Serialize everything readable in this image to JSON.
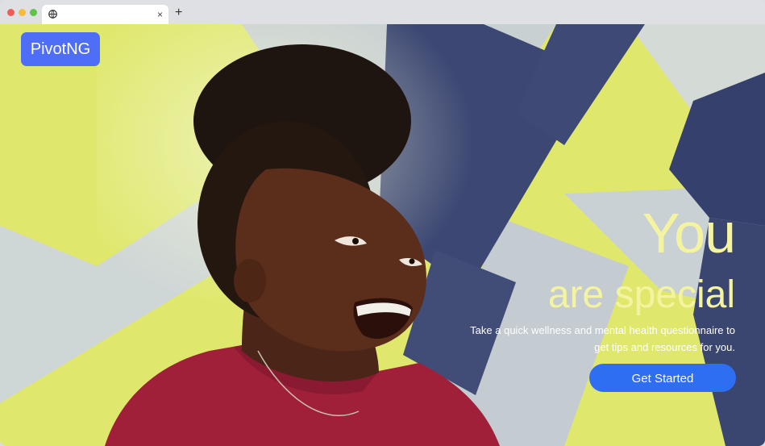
{
  "browser": {
    "tab_title": "",
    "new_tab_symbol": "+",
    "close_symbol": "×",
    "favicon": "globe-icon"
  },
  "page": {
    "logo_text": "PivotNG",
    "headline_line1": "You",
    "headline_line2": "are special",
    "description": "Take a quick wellness and mental health questionnaire to get tips and resources for you.",
    "cta_label": "Get Started"
  },
  "colors": {
    "logo_bg": "#4f6ef7",
    "headline": "#f4f4a0",
    "cta_bg": "#2e6ef0",
    "wall_yellow": "#dfe86c",
    "wall_navy": "#3c4773"
  }
}
